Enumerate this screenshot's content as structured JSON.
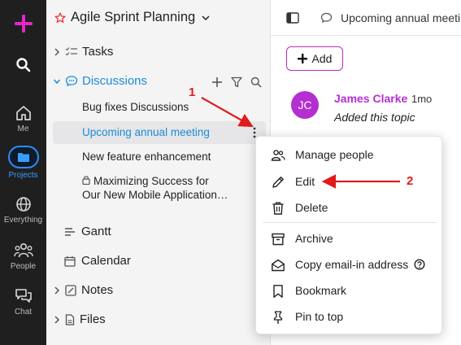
{
  "rail": {
    "items": [
      {
        "icon": "plus-icon",
        "label": ""
      },
      {
        "icon": "search-icon",
        "label": ""
      },
      {
        "icon": "home-icon",
        "label": "Me"
      },
      {
        "icon": "folder-icon",
        "label": "Projects"
      },
      {
        "icon": "globe-icon",
        "label": "Everything"
      },
      {
        "icon": "people-icon",
        "label": "People"
      },
      {
        "icon": "chat-icon",
        "label": "Chat"
      }
    ],
    "accent_color": "#e627c7",
    "active_color": "#2f8cff"
  },
  "sidebar": {
    "project_title": "Agile Sprint Planning",
    "sections": {
      "tasks": "Tasks",
      "discussions": "Discussions",
      "gantt": "Gantt",
      "calendar": "Calendar",
      "notes": "Notes",
      "files": "Files"
    },
    "discussion_items": [
      "Bug fixes Discussions",
      "Upcoming annual meeting",
      "New feature enhancement"
    ],
    "locked_item_line1": "Maximizing Success for",
    "locked_item_line2": "Our New Mobile Application…",
    "link_color": "#1a8cd8"
  },
  "main": {
    "tab_title": "Upcoming annual meeti",
    "add_label": "Add",
    "comment": {
      "avatar_initials": "JC",
      "author": "James Clarke",
      "time": "1mo",
      "text": "Added this topic"
    }
  },
  "menu": {
    "items": [
      {
        "icon": "people-icon",
        "label": "Manage people"
      },
      {
        "icon": "pencil-icon",
        "label": "Edit"
      },
      {
        "icon": "trash-icon",
        "label": "Delete"
      },
      {
        "icon": "archive-icon",
        "label": "Archive"
      },
      {
        "icon": "envelope-open-icon",
        "label": "Copy email-in address"
      },
      {
        "icon": "bookmark-icon",
        "label": "Bookmark"
      },
      {
        "icon": "pin-icon",
        "label": "Pin to top"
      }
    ]
  },
  "annotations": {
    "step1": "1",
    "step2": "2",
    "color": "#e01b1b"
  }
}
